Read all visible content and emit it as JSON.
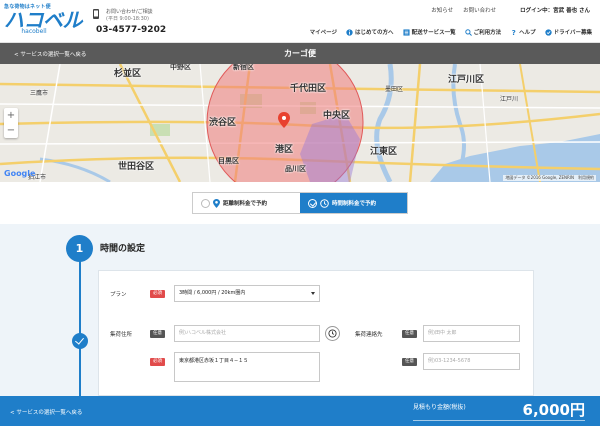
{
  "header": {
    "logo_tagline": "急な荷物はネット便",
    "logo_main": "ハコベル",
    "logo_sub": "hacobell",
    "contact_label": "お問い合わせ/ご相談",
    "contact_hours": "(平日 9:00-18:30)",
    "contact_phone": "03-4577-9202",
    "util_links": [
      "お知らせ",
      "お問い合わせ"
    ],
    "login_status": "ログイン中：宮武 善也 さん",
    "nav": [
      {
        "label": "マイページ",
        "icon": "user-icon"
      },
      {
        "label": "はじめての方へ",
        "icon": "info-icon"
      },
      {
        "label": "配送サービス一覧",
        "icon": "list-icon"
      },
      {
        "label": "ご利用方法",
        "icon": "search-icon"
      },
      {
        "label": "ヘルプ",
        "icon": "help-icon"
      },
      {
        "label": "ドライバー募集",
        "icon": "truck-icon"
      }
    ]
  },
  "titlebar": {
    "back_link": "< サービスの選択一覧へ戻る",
    "title": "カーゴ便"
  },
  "map": {
    "labels": [
      "杉並区",
      "中野区",
      "新宿区",
      "千代田区",
      "江戸川区",
      "渋谷区",
      "中央区",
      "港区",
      "江東区",
      "世田谷区",
      "目黒区",
      "品川区",
      "三鷹市",
      "狛江市",
      "墨田区",
      "江戸川"
    ],
    "zoom_in": "+",
    "zoom_out": "−",
    "google": "Google",
    "attribution": "地図データ ©2016 Google, ZENRIN　利用規約",
    "radius_color": "#f07b7b"
  },
  "mode_toggle": {
    "options": [
      {
        "label": "距離制料金で予約",
        "selected": false
      },
      {
        "label": "時間制料金で予約",
        "selected": true
      }
    ]
  },
  "step": {
    "number": "1",
    "title": "時間の設定"
  },
  "form": {
    "plan_label": "プラン",
    "required_badge": "必須",
    "optional_badge": "任意",
    "plan_value": "3時間 / 6,000円 / 20km圏内",
    "pickup_address_label": "集荷住所",
    "pickup_company_placeholder": "例)ハコベル株式会社",
    "pickup_address_value": "東京都港区赤坂１丁目４−１５",
    "pickup_contact_label": "集荷連絡先",
    "contact_name_placeholder": "例)田中 太郎",
    "contact_phone_placeholder": "例)03-1234-5678"
  },
  "footer": {
    "back_link": "< サービスの選択一覧へ戻る",
    "estimate_label": "見積もり金額(税抜)",
    "estimate_price": "6,000円"
  },
  "colors": {
    "brand": "#1f7ec9",
    "required": "#e14b4b",
    "titlebar": "#5a5a5a"
  }
}
